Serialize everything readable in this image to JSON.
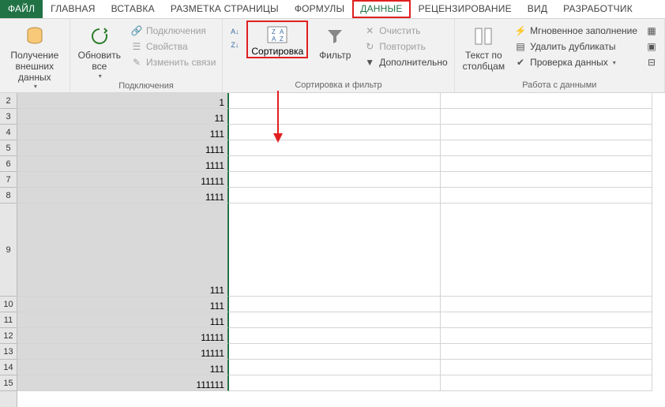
{
  "tabs": {
    "file": "ФАЙЛ",
    "home": "ГЛАВНАЯ",
    "insert": "ВСТАВКА",
    "pagelayout": "РАЗМЕТКА СТРАНИЦЫ",
    "formulas": "ФОРМУЛЫ",
    "data": "ДАННЫЕ",
    "review": "РЕЦЕНЗИРОВАНИЕ",
    "view": "ВИД",
    "developer": "РАЗРАБОТЧИК"
  },
  "ribbon": {
    "external": {
      "get": "Получение\nвнешних данных"
    },
    "connections": {
      "refresh": "Обновить\nвсе",
      "conn": "Подключения",
      "props": "Свойства",
      "edit": "Изменить связи",
      "group": "Подключения"
    },
    "sortfilter": {
      "sort": "Сортировка",
      "filter": "Фильтр",
      "clear": "Очистить",
      "reapply": "Повторить",
      "advanced": "Дополнительно",
      "group": "Сортировка и фильтр"
    },
    "datatools": {
      "textcol": "Текст по\nстолбцам",
      "flash": "Мгновенное заполнение",
      "dedupe": "Удалить дубликаты",
      "validation": "Проверка данных",
      "group": "Работа с данными"
    }
  },
  "rows": [
    {
      "n": "2",
      "v": "1"
    },
    {
      "n": "3",
      "v": "11"
    },
    {
      "n": "4",
      "v": "111"
    },
    {
      "n": "5",
      "v": "1111"
    },
    {
      "n": "6",
      "v": "1111"
    },
    {
      "n": "7",
      "v": "11111"
    },
    {
      "n": "8",
      "v": "1111"
    },
    {
      "n": "9",
      "v": "111",
      "tall": true
    },
    {
      "n": "10",
      "v": "111"
    },
    {
      "n": "11",
      "v": "111"
    },
    {
      "n": "12",
      "v": "11111"
    },
    {
      "n": "13",
      "v": "11111"
    },
    {
      "n": "14",
      "v": "111"
    },
    {
      "n": "15",
      "v": "111111"
    }
  ]
}
